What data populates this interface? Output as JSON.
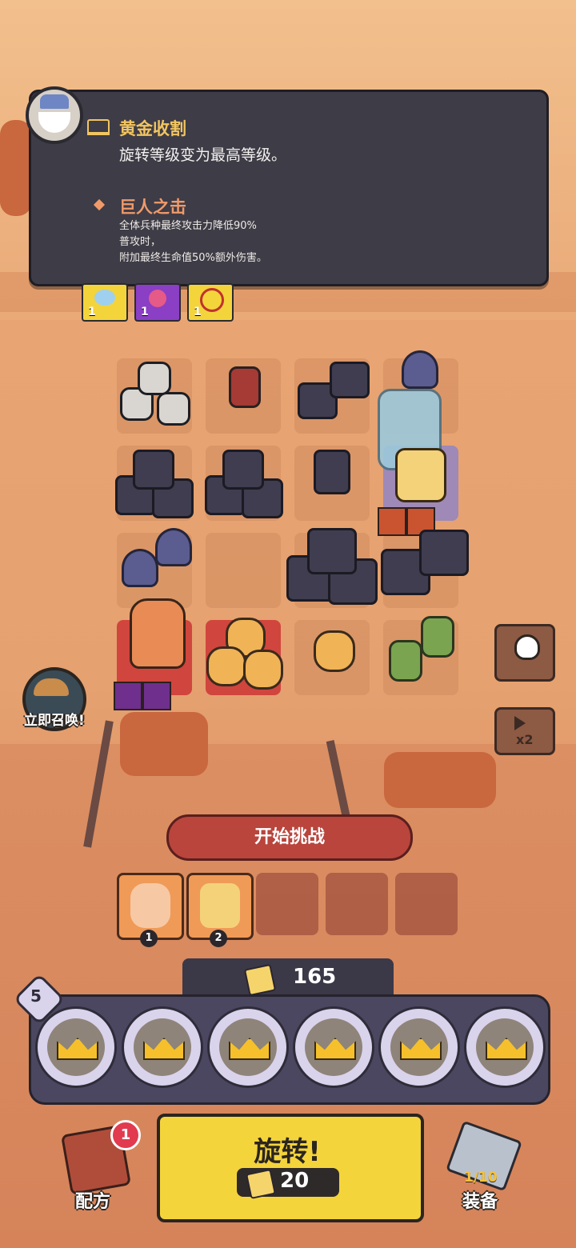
{
  "tooltip": {
    "main_skill_title": "黄金收割",
    "main_skill_desc": "旋转等级变为最高等级。",
    "sub_skill_title": "巨人之击",
    "sub_skill_desc_1": "全体兵种最终攻击力降低90%",
    "sub_skill_desc_2": "普攻时，",
    "sub_skill_desc_3": "附加最终生命值50%额外伤害。"
  },
  "buffs": [
    {
      "icon": "wings-icon",
      "count": "1",
      "color": "#f4d43b"
    },
    {
      "icon": "heart-amulet-icon",
      "count": "1",
      "color": "#8a3fc4"
    },
    {
      "icon": "target-icon",
      "count": "1",
      "color": "#f4d43b"
    }
  ],
  "side_buttons": {
    "map_icon": "skull-pin-icon",
    "speed_label": "x2"
  },
  "summon": {
    "label": "立即召唤!"
  },
  "challenge": {
    "start_label": "开始挑战"
  },
  "queue_slots": [
    {
      "hero": "fox-hood-hero",
      "number": "1"
    },
    {
      "hero": "crown-king-hero",
      "number": "2"
    },
    {
      "hero": null
    },
    {
      "hero": null
    },
    {
      "hero": null
    }
  ],
  "gold": {
    "amount": "165"
  },
  "spinner": {
    "level": "5",
    "rings": [
      "crown-icon",
      "crown-icon",
      "crown-icon",
      "crown-icon",
      "crown-icon",
      "crown-icon"
    ]
  },
  "bottom": {
    "recipe_label": "配方",
    "recipe_badge": "1",
    "spin_label": "旋转!",
    "spin_cost": "20",
    "equip_label": "装备",
    "equip_count": "1/10"
  },
  "colors": {
    "tooltip_bg": "#3e3c46",
    "title_gold": "#f2c560",
    "sub_orange": "#f09a6a",
    "spin_yellow": "#f4d43b",
    "start_red": "#b9453d"
  }
}
